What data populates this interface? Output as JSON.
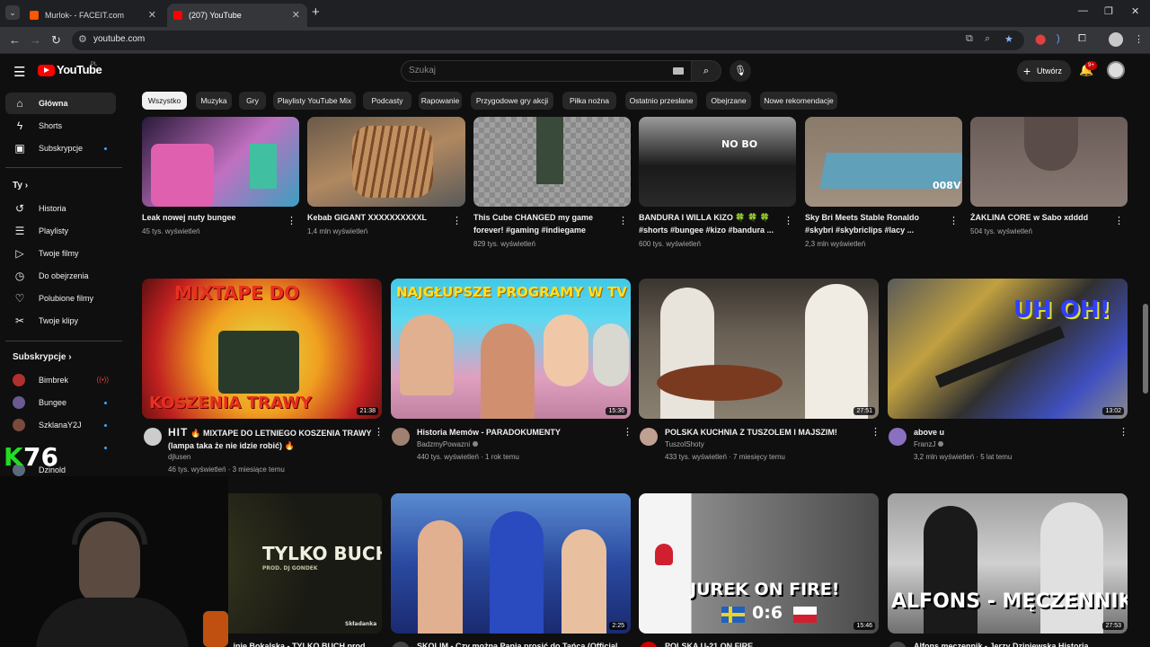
{
  "browser": {
    "tabs": [
      {
        "title": "Murlok- - FACEIT.com",
        "fav_color": "#ff5500",
        "active": false
      },
      {
        "title": "(207) YouTube",
        "fav_color": "#ff0000",
        "active": true
      }
    ],
    "url": "youtube.com"
  },
  "header": {
    "logo_text": "YouTube",
    "logo_region": "PL",
    "search_placeholder": "Szukaj",
    "create_label": "Utwórz",
    "notif_count": "9+"
  },
  "sidebar": {
    "main": [
      {
        "label": "Główna",
        "icon": "home-icon",
        "glyph": "⌂",
        "active": true
      },
      {
        "label": "Shorts",
        "icon": "shorts-icon",
        "glyph": "⚡",
        "active": false
      },
      {
        "label": "Subskrypcje",
        "icon": "subscriptions-icon",
        "glyph": "▣",
        "active": false,
        "dot": true
      }
    ],
    "you_heading": "Ty",
    "you": [
      {
        "label": "Historia",
        "icon": "history-icon",
        "glyph": "↺"
      },
      {
        "label": "Playlisty",
        "icon": "playlists-icon",
        "glyph": "☰"
      },
      {
        "label": "Twoje filmy",
        "icon": "your-videos-icon",
        "glyph": "▶"
      },
      {
        "label": "Do obejrzenia",
        "icon": "watch-later-icon",
        "glyph": "◷"
      },
      {
        "label": "Polubione filmy",
        "icon": "liked-icon",
        "glyph": "♥"
      },
      {
        "label": "Twoje klipy",
        "icon": "clips-icon",
        "glyph": "✂"
      }
    ],
    "subs_heading": "Subskrypcje",
    "subs": [
      {
        "label": "Bimbrek",
        "color": "#b03030",
        "live": true
      },
      {
        "label": "Bungee",
        "color": "#6a5a90",
        "live": false
      },
      {
        "label": "SzklanaY2J",
        "color": "#7a4a3a",
        "live": false
      },
      {
        "label": "",
        "color": "#333333",
        "live": false
      },
      {
        "label": "Dzinold",
        "color": "#5a6a7a",
        "live": false
      }
    ]
  },
  "chips": [
    {
      "label": "Wszystko",
      "active": true
    },
    {
      "label": "Muzyka"
    },
    {
      "label": "Gry"
    },
    {
      "label": "Playlisty YouTube Mix"
    },
    {
      "label": "Podcasty"
    },
    {
      "label": "Rapowanie"
    },
    {
      "label": "Przygodowe gry akcji"
    },
    {
      "label": "Piłka nożna"
    },
    {
      "label": "Ostatnio przesłane"
    },
    {
      "label": "Obejrzane"
    },
    {
      "label": "Nowe rekomendacje"
    }
  ],
  "shorts_row": [
    {
      "title": "Leak nowej nuty bungee",
      "meta": "45 tys. wyświetleń",
      "thumb": "#5a3a6a"
    },
    {
      "title": "Kebab GIGANT XXXXXXXXXXL",
      "meta": "1,4 mln wyświetleń",
      "thumb": "#7a5a40"
    },
    {
      "title": "This Cube CHANGED my game forever! #gaming #indiegame",
      "meta": "829 tys. wyświetleń",
      "thumb": "#6a6a6a"
    },
    {
      "title": "BANDURA I WILLA KIZO 🍀 🍀 🍀 #shorts #bungee #kizo #bandura ...",
      "meta": "600 tys. wyświetleń",
      "thumb": "#3a3a3a"
    },
    {
      "title": "Sky Bri Meets Stable Ronaldo #skybri #skybriclips #lacy ...",
      "meta": "2,3 mln wyświetleń",
      "thumb": "#6a5a50"
    },
    {
      "title": "ŻAKLINA CORE w Sabo xdddd",
      "meta": "504 tys. wyświetleń",
      "thumb": "#5a5050"
    }
  ],
  "videos_row1": [
    {
      "title": "🔥 MIXTAPE DO LETNIEGO KOSZENIA TRAWY (lampa taka że nie idzie robić) 🔥",
      "title_prefix": "HIT",
      "channel": "djlusen",
      "meta": "46 tys. wyświetleń · 3 miesiące temu",
      "duration": "21:38",
      "thumb_text_top": "MIXTAPE DO",
      "thumb_text_bottom": "KOSZENIA TRAWY",
      "av_color": "#cccccc"
    },
    {
      "title": "Historia Memów - PARADOKUMENTY",
      "channel": "BadzmyPowazni",
      "meta": "440 tys. wyświetleń · 1 rok temu",
      "duration": "15:36",
      "thumb_text_top": "NAJGŁUPSZE PROGRAMY W TV",
      "av_color": "#a08070"
    },
    {
      "title": "POLSKA KUCHNIA Z TUSZOLEM I MAJSZIM!",
      "channel": "TuszolShoty",
      "meta": "433 tys. wyświetleń · 7 miesięcy temu",
      "duration": "27:51",
      "av_color": "#c0a090"
    },
    {
      "title": "above u",
      "channel": "FranzJ",
      "meta": "3,2 mln wyświetleń · 5 lat temu",
      "duration": "13:02",
      "thumb_text_top": "UH OH!",
      "av_color": "#8a70c0"
    }
  ],
  "videos_row2": [
    {
      "title": "...inie Bokalska - TYLKO BUCH prod.",
      "thumb_text_top": "TYLKO BUCH",
      "thumb_text_small": "PROD. DJ GONDEK",
      "thumb_text_corner": "Składanka",
      "av_color": "#444444"
    },
    {
      "title": "SKOLIM - Czy można Panią prosić do Tańca (Official ...",
      "duration": "2:25",
      "av_color": "#444444"
    },
    {
      "title": "POLSKA U-21 ON FIRE",
      "duration": "15:46",
      "thumb_text_top": "JUREK ON FIRE!",
      "thumb_score": "0:6",
      "av_color": "#cc0000"
    },
    {
      "title": "Alfons męczennik - Jerzy Dziniewska Historia ...",
      "duration": "27:53",
      "thumb_text_top": "ALFONS - MĘCZENNIK",
      "av_color": "#444444"
    }
  ],
  "overlay": {
    "logo_text": "K76"
  }
}
